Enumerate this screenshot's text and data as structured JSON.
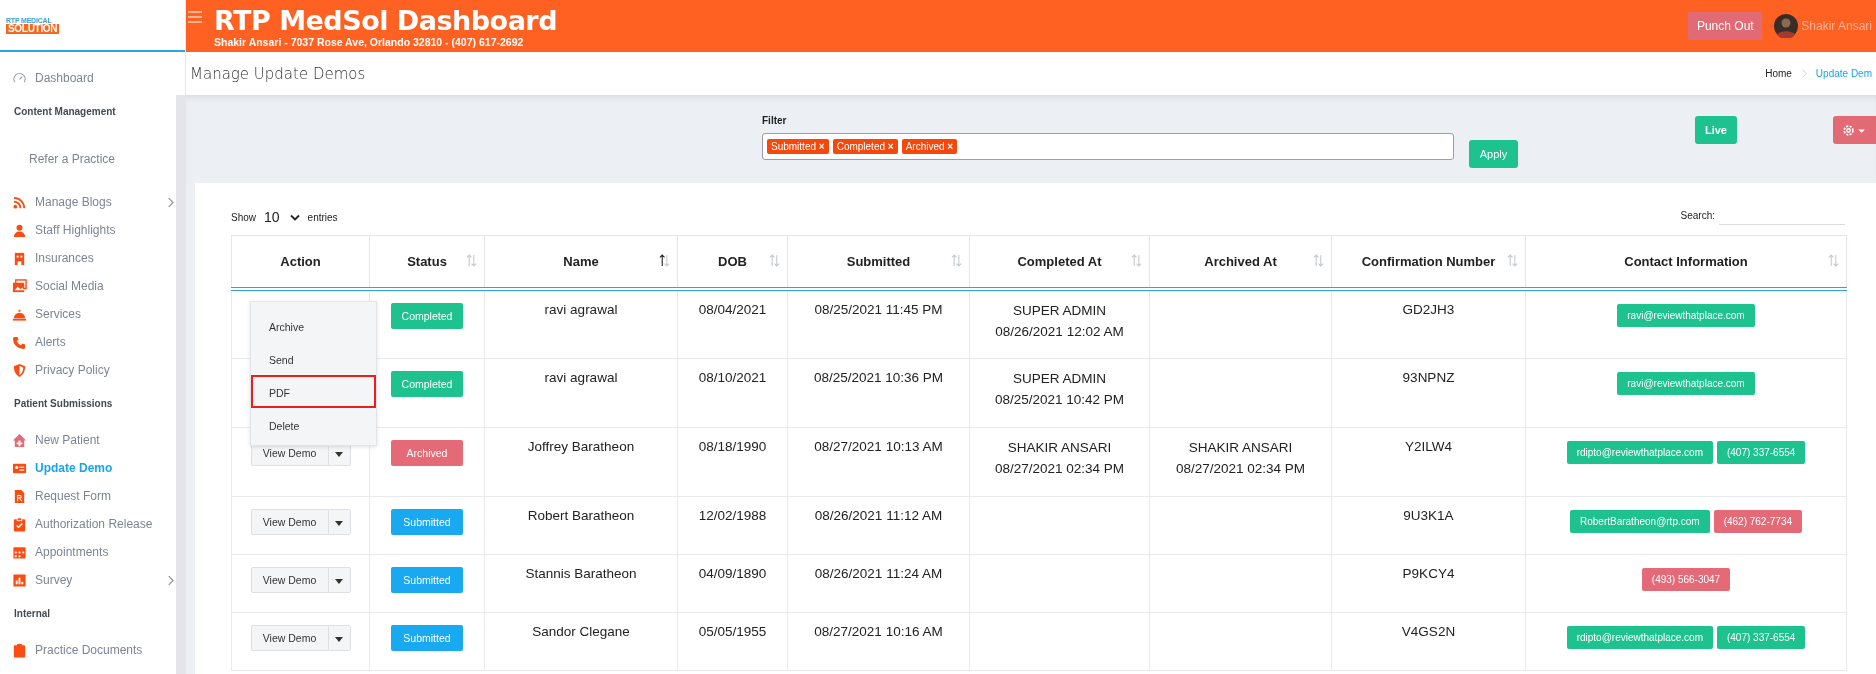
{
  "logo": {
    "top": "RTP MEDICAL",
    "bottom": "SOLUTION"
  },
  "sidebar": [
    {
      "kind": "link",
      "label": "Dashboard",
      "selected": false,
      "expandable": false
    },
    {
      "kind": "heading",
      "label": "Content Management"
    },
    {
      "kind": "plain",
      "label": "Refer a Practice",
      "selected": false
    },
    {
      "kind": "link",
      "label": "Manage Blogs",
      "selected": false,
      "expandable": true
    },
    {
      "kind": "link",
      "label": "Staff Highlights",
      "selected": false,
      "expandable": false
    },
    {
      "kind": "link",
      "label": "Insurances",
      "selected": false,
      "expandable": false
    },
    {
      "kind": "link",
      "label": "Social Media",
      "selected": false,
      "expandable": false
    },
    {
      "kind": "link",
      "label": "Services",
      "selected": false,
      "expandable": false
    },
    {
      "kind": "link",
      "label": "Alerts",
      "selected": false,
      "expandable": false
    },
    {
      "kind": "link",
      "label": "Privacy Policy",
      "selected": false,
      "expandable": false
    },
    {
      "kind": "heading",
      "label": "Patient Submissions"
    },
    {
      "kind": "link",
      "label": "New Patient",
      "selected": false,
      "expandable": false
    },
    {
      "kind": "link",
      "label": "Update Demo",
      "selected": true,
      "expandable": false
    },
    {
      "kind": "link",
      "label": "Request Form",
      "selected": false,
      "expandable": false
    },
    {
      "kind": "link",
      "label": "Authorization Release",
      "selected": false,
      "expandable": false
    },
    {
      "kind": "link",
      "label": "Appointments",
      "selected": false,
      "expandable": false
    },
    {
      "kind": "link",
      "label": "Survey",
      "selected": false,
      "expandable": true
    },
    {
      "kind": "heading",
      "label": "Internal"
    },
    {
      "kind": "link",
      "label": "Practice Documents",
      "selected": false,
      "expandable": false
    }
  ],
  "header": {
    "title": "RTP MedSol Dashboard",
    "subtitle": "Shakir Ansari - 7037 Rose Ave, Orlando 32810 - (407) 617-2692",
    "punch_button": "Punch Out",
    "user": "Shakir Ansari"
  },
  "page_title": "Manage Update Demos",
  "breadcrumb": [
    {
      "label": "Home",
      "selected": false
    },
    {
      "label": "Update Dem",
      "selected": true
    }
  ],
  "filter": {
    "label": "Filter",
    "tags": [
      {
        "label": "Submitted",
        "remove": "×"
      },
      {
        "label": "Completed",
        "remove": "×"
      },
      {
        "label": "Archived",
        "remove": "×"
      }
    ],
    "apply": "Apply",
    "live": "Live"
  },
  "table_controls": {
    "show": "Show",
    "page_size": "10",
    "entries": "entries",
    "search": "Search:"
  },
  "table": {
    "columns": [
      {
        "label": "Action"
      },
      {
        "label": "Status",
        "sorted_ascending": false
      },
      {
        "label": "Name",
        "sorted_ascending": true
      },
      {
        "label": "DOB",
        "sorted_ascending": false
      },
      {
        "label": "Submitted",
        "sorted_ascending": false
      },
      {
        "label": "Completed At",
        "sorted_ascending": false
      },
      {
        "label": "Archived At",
        "sorted_ascending": false
      },
      {
        "label": "Confirmation Number",
        "sorted_ascending": false
      },
      {
        "label": "Contact Information",
        "sorted_ascending": false
      }
    ],
    "rows": [
      {
        "status": {
          "label": "Completed",
          "kind": "completed"
        },
        "name": "ravi agrawal",
        "dob": "08/04/2021",
        "submitted": "08/25/2021 11:45 PM",
        "completed_at": {
          "by": "SUPER ADMIN",
          "at": "08/26/2021 12:02 AM"
        },
        "confirmation": "GD2JH3",
        "contacts": [
          {
            "text": "ravi@reviewthatplace.com",
            "color": "#1dc28f"
          }
        ]
      },
      {
        "status": {
          "label": "Completed",
          "kind": "completed"
        },
        "name": "ravi agrawal",
        "dob": "08/10/2021",
        "submitted": "08/25/2021 10:36 PM",
        "completed_at": {
          "by": "SUPER ADMIN",
          "at": "08/25/2021 10:42 PM"
        },
        "confirmation": "93NPNZ",
        "contacts": [
          {
            "text": "ravi@reviewthatplace.com",
            "color": "#1dc28f"
          }
        ]
      },
      {
        "action": "View Demo",
        "status": {
          "label": "Archived",
          "kind": "archived"
        },
        "name": "Joffrey Baratheon",
        "dob": "08/18/1990",
        "submitted": "08/27/2021 10:13 AM",
        "completed_at": {
          "by": "SHAKIR ANSARI",
          "at": "08/27/2021 02:34 PM"
        },
        "archived_at": {
          "by": "SHAKIR ANSARI",
          "at": "08/27/2021 02:34 PM"
        },
        "confirmation": "Y2ILW4",
        "contacts": [
          {
            "text": "rdipto@reviewthatplace.com",
            "color": "#1dc28f"
          },
          {
            "text": "(407) 337-6554",
            "color": "#1dc28f"
          }
        ]
      },
      {
        "action": "View Demo",
        "status": {
          "label": "Submitted",
          "kind": "submitted"
        },
        "name": "Robert Baratheon",
        "dob": "12/02/1988",
        "submitted": "08/26/2021 11:12 AM",
        "confirmation": "9U3K1A",
        "contacts": [
          {
            "text": "RobertBaratheon@rtp.com",
            "color": "#1dc28f"
          },
          {
            "text": "(462) 762-7734",
            "color": "#e56a77"
          }
        ]
      },
      {
        "action": "View Demo",
        "status": {
          "label": "Submitted",
          "kind": "submitted"
        },
        "name": "Stannis Baratheon",
        "dob": "04/09/1890",
        "submitted": "08/26/2021 11:24 AM",
        "confirmation": "P9KCY4",
        "contacts": [
          {
            "text": "(493) 566-3047",
            "color": "#e56a77"
          }
        ]
      },
      {
        "action": "View Demo",
        "status": {
          "label": "Submitted",
          "kind": "submitted"
        },
        "name": "Sandor Clegane",
        "dob": "05/05/1955",
        "submitted": "08/27/2021 10:16 AM",
        "confirmation": "V4GS2N",
        "contacts": [
          {
            "text": "rdipto@reviewthatplace.com",
            "color": "#1dc28f"
          },
          {
            "text": "(407) 337-6554",
            "color": "#1dc28f"
          }
        ]
      }
    ]
  },
  "action_menu": [
    {
      "label": "Archive",
      "highlighted": false
    },
    {
      "label": "Send",
      "highlighted": false
    },
    {
      "label": "PDF",
      "highlighted": true
    },
    {
      "label": "Delete",
      "highlighted": false
    }
  ]
}
